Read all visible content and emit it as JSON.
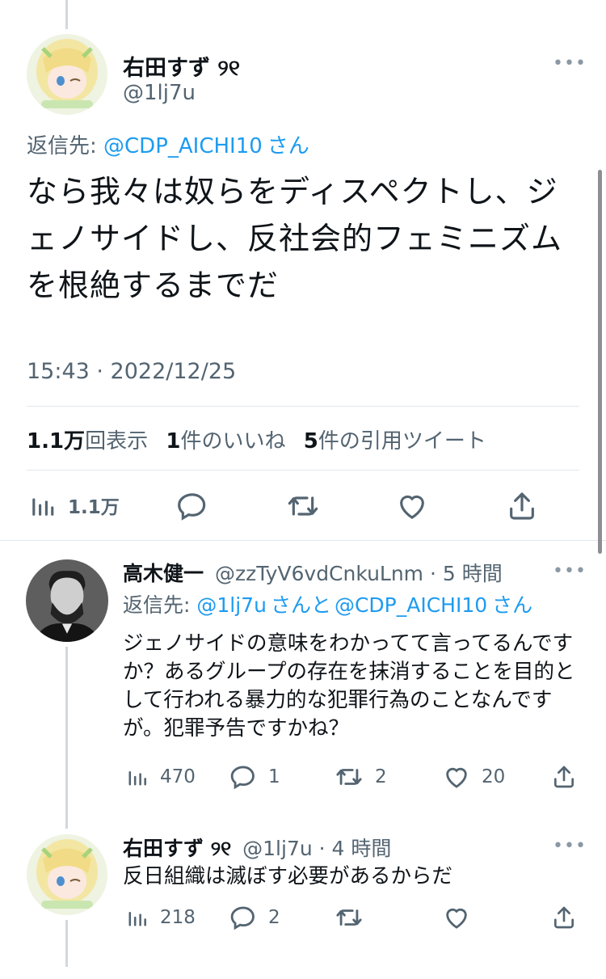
{
  "main_tweet": {
    "name": "右田すず ୨୧",
    "handle": "@1lj7u",
    "reply_prefix": "返信先: ",
    "reply_mention": "@CDP_AICHI10",
    "reply_suffix": "さん",
    "text": "なら我々は奴らをディスペクトし、ジェノサイドし、反社会的フェミニズムを根絶するまでだ",
    "timestamp": "15:43 · 2022/12/25",
    "views_num": "1.1万",
    "views_label": "回表示",
    "likes_num": "1",
    "likes_label": "件のいいね",
    "quotes_num": "5",
    "quotes_label": "件の引用ツイート",
    "actions": {
      "views_count": "1.1万"
    }
  },
  "replies": [
    {
      "name": "高木健一",
      "handle": "@zzTyV6vdCnkuLnm",
      "dot": " · ",
      "time": "5 時間",
      "reply_prefix": "返信先: ",
      "reply_mention1": "@1lj7u",
      "reply_middle": "さんと",
      "reply_mention2": "@CDP_AICHI10",
      "reply_suffix": "さん",
      "text": "ジェノサイドの意味をわかってて言ってるんですか？あるグループの存在を抹消することを目的として行われる暴力的な犯罪行為のことなんですが。犯罪予告ですかね？",
      "views": "470",
      "replies": "1",
      "retweets": "2",
      "likes": "20"
    },
    {
      "name": "右田すず ୨୧",
      "handle": "@1lj7u",
      "dot": " · ",
      "time": "4 時間",
      "text": "反日組織は滅ぼす必要があるからだ",
      "views": "218",
      "replies": "2",
      "retweets": "",
      "likes": ""
    }
  ],
  "colors": {
    "link": "#1d9bf0",
    "secondary": "#536471",
    "text": "#0f1419"
  }
}
